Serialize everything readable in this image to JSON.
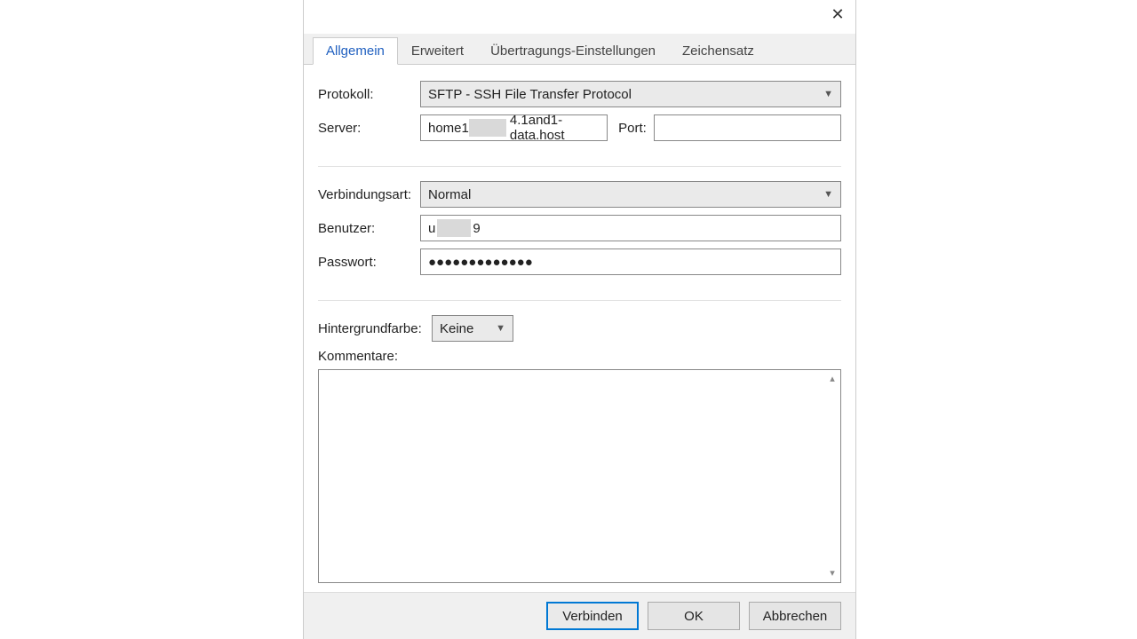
{
  "tabs": {
    "general": "Allgemein",
    "advanced": "Erweitert",
    "transfer": "Übertragungs-Einstellungen",
    "charset": "Zeichensatz"
  },
  "labels": {
    "protocol": "Protokoll:",
    "server": "Server:",
    "port": "Port:",
    "logontype": "Verbindungsart:",
    "user": "Benutzer:",
    "password": "Passwort:",
    "bgcolor": "Hintergrundfarbe:",
    "comments": "Kommentare:"
  },
  "values": {
    "protocol": "SFTP - SSH File Transfer Protocol",
    "server_prefix": "home1",
    "server_suffix": "4.1and1-data.host",
    "port": "",
    "logontype": "Normal",
    "user_prefix": "u",
    "user_suffix": "9",
    "password": "●●●●●●●●●●●●●",
    "bgcolor": "Keine",
    "comments": ""
  },
  "buttons": {
    "connect": "Verbinden",
    "ok": "OK",
    "cancel": "Abbrechen"
  }
}
